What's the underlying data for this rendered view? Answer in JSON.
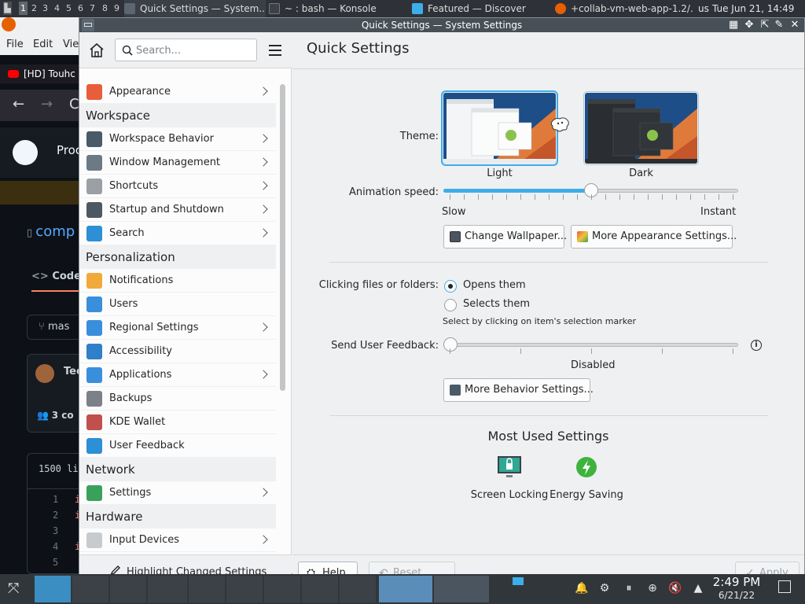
{
  "top_panel": {
    "desktops": [
      "1",
      "2",
      "3",
      "4",
      "5",
      "6",
      "7",
      "8",
      "9"
    ],
    "tasks": [
      {
        "label": "Quick Settings  — System...",
        "active": true
      },
      {
        "label": "~ : bash — Konsole",
        "active": false
      },
      {
        "label": "Featured — Discover",
        "active": false
      },
      {
        "label": "+collab-vm-web-app-1.2/...",
        "active": false
      }
    ],
    "locale": "us",
    "datetime": "Tue Jun 21, 14:49"
  },
  "browser": {
    "menu": [
      "File",
      "Edit",
      "Vie"
    ],
    "tab_title": "[HD] Touhc",
    "product": "Proc",
    "repo_link": "comp",
    "code_tab": "Code",
    "branch": "mas",
    "user": "Tec",
    "contributors": "3 co",
    "lines_info": "1500 li",
    "line_numbers": [
      "1",
      "2",
      "3",
      "4",
      "5"
    ],
    "line_starts": [
      "i",
      "i",
      "",
      "i",
      ""
    ]
  },
  "window": {
    "title": "Quick Settings  — System Settings"
  },
  "sidebar": {
    "search_placeholder": "Search...",
    "items": [
      {
        "type": "item",
        "label": "Appearance",
        "icon": "appearance-icon",
        "color": "#e85d3a",
        "chevron": true
      },
      {
        "type": "category",
        "label": "Workspace"
      },
      {
        "type": "item",
        "label": "Workspace Behavior",
        "icon": "workspace-behavior-icon",
        "color": "#4a5a66",
        "chevron": true
      },
      {
        "type": "item",
        "label": "Window Management",
        "icon": "window-management-icon",
        "color": "#6c7a86",
        "chevron": true
      },
      {
        "type": "item",
        "label": "Shortcuts",
        "icon": "keyboard-icon",
        "color": "#9aa0a6",
        "chevron": true
      },
      {
        "type": "item",
        "label": "Startup and Shutdown",
        "icon": "startup-icon",
        "color": "#4c5963",
        "chevron": true
      },
      {
        "type": "item",
        "label": "Search",
        "icon": "search-icon",
        "color": "#2d8fd5",
        "chevron": true
      },
      {
        "type": "category",
        "label": "Personalization"
      },
      {
        "type": "item",
        "label": "Notifications",
        "icon": "bell-icon",
        "color": "#f2a93b",
        "chevron": false
      },
      {
        "type": "item",
        "label": "Users",
        "icon": "users-icon",
        "color": "#3a8fdc",
        "chevron": false
      },
      {
        "type": "item",
        "label": "Regional Settings",
        "icon": "regional-icon",
        "color": "#3a8fdc",
        "chevron": true
      },
      {
        "type": "item",
        "label": "Accessibility",
        "icon": "accessibility-icon",
        "color": "#2f7fc9",
        "chevron": false
      },
      {
        "type": "item",
        "label": "Applications",
        "icon": "applications-icon",
        "color": "#3a8fdc",
        "chevron": true
      },
      {
        "type": "item",
        "label": "Backups",
        "icon": "backups-icon",
        "color": "#7b8186",
        "chevron": false
      },
      {
        "type": "item",
        "label": "KDE Wallet",
        "icon": "wallet-icon",
        "color": "#c0504d",
        "chevron": false
      },
      {
        "type": "item",
        "label": "User Feedback",
        "icon": "feedback-icon",
        "color": "#2d8fd5",
        "chevron": false
      },
      {
        "type": "category",
        "label": "Network"
      },
      {
        "type": "item",
        "label": "Settings",
        "icon": "globe-icon",
        "color": "#3aa15a",
        "chevron": true
      },
      {
        "type": "category",
        "label": "Hardware"
      },
      {
        "type": "item",
        "label": "Input Devices",
        "icon": "mouse-icon",
        "color": "#c8cbce",
        "chevron": true
      }
    ],
    "highlight_label": "Highlight Changed Settings"
  },
  "content": {
    "title": "Quick Settings",
    "theme_label": "Theme:",
    "themes": [
      {
        "name": "Light",
        "selected": true
      },
      {
        "name": "Dark",
        "selected": false
      }
    ],
    "animation_label": "Animation speed:",
    "animation_value": 0.5,
    "animation_min": "Slow",
    "animation_max": "Instant",
    "change_wallpaper": "Change Wallpaper...",
    "more_appearance": "More Appearance Settings...",
    "clicking_label": "Clicking files or folders:",
    "click_options": [
      {
        "label": "Opens them",
        "selected": true
      },
      {
        "label": "Selects them",
        "selected": false
      }
    ],
    "select_hint": "Select by clicking on item's selection marker",
    "feedback_label": "Send User Feedback:",
    "feedback_value": 0,
    "feedback_status": "Disabled",
    "more_behavior": "More Behavior Settings...",
    "most_used_title": "Most Used Settings",
    "most_used": [
      {
        "label": "Screen Locking",
        "icon": "screen-lock-icon"
      },
      {
        "label": "Energy Saving",
        "icon": "energy-saving-icon"
      }
    ]
  },
  "footer": {
    "help": "Help",
    "reset": "Reset",
    "apply": "Apply"
  },
  "bottom_panel": {
    "time": "2:49 PM",
    "date": "6/21/22"
  },
  "colors": {
    "accent": "#3daee9",
    "panel": "#31363b",
    "titlebar": "#475057"
  }
}
